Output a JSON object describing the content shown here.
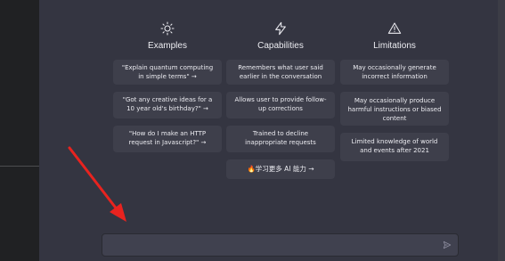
{
  "columns": [
    {
      "title": "Examples",
      "icon": "sun-icon",
      "cards": [
        "\"Explain quantum computing in simple terms\" →",
        "\"Got any creative ideas for a 10 year old's birthday?\" →",
        "\"How do I make an HTTP request in Javascript?\" →"
      ]
    },
    {
      "title": "Capabilities",
      "icon": "lightning-icon",
      "cards": [
        "Remembers what user said earlier in the conversation",
        "Allows user to provide follow-up corrections",
        "Trained to decline inappropriate requests",
        "🔥学习更多 AI 能力 →"
      ]
    },
    {
      "title": "Limitations",
      "icon": "warning-icon",
      "cards": [
        "May occasionally generate incorrect information",
        "May occasionally produce harmful instructions or biased content",
        "Limited knowledge of world and events after 2021"
      ]
    }
  ],
  "input": {
    "placeholder": ""
  },
  "colors": {
    "background": "#343541",
    "sidebar": "#202123",
    "card": "#3e3f4b",
    "annotation_arrow": "#e8231f"
  }
}
